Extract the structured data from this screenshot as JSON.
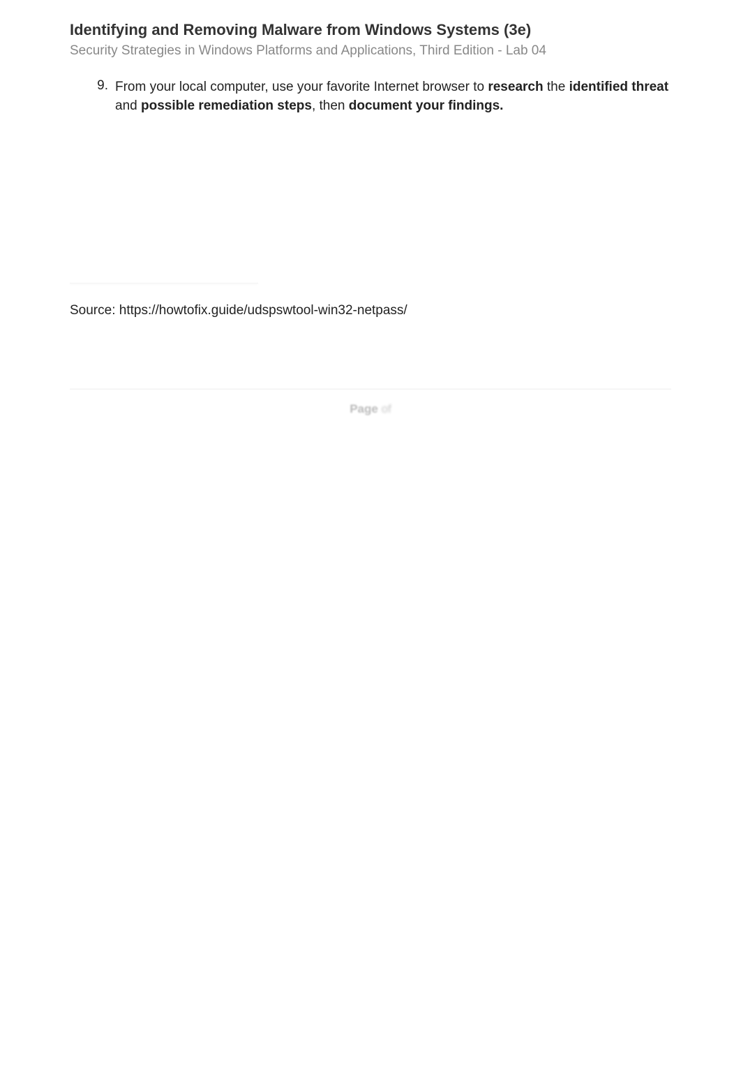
{
  "header": {
    "title": "Identifying and Removing Malware from Windows Systems (3e)",
    "subtitle": "Security Strategies in Windows Platforms and Applications, Third Edition - Lab 04"
  },
  "list": {
    "number": "9.",
    "text_part1": "From your local computer, use your favorite Internet browser to ",
    "text_bold1": "research",
    "text_part2": " the ",
    "text_bold2": "identified threat",
    "text_part3": " and ",
    "text_bold3": "possible remediation steps",
    "text_part4": ", then ",
    "text_bold4": "document your findings."
  },
  "source": {
    "text": "Source: https://howtofix.guide/udspswtool-win32-netpass/"
  },
  "footer": {
    "page_word": "Page",
    "page_num": " of "
  }
}
